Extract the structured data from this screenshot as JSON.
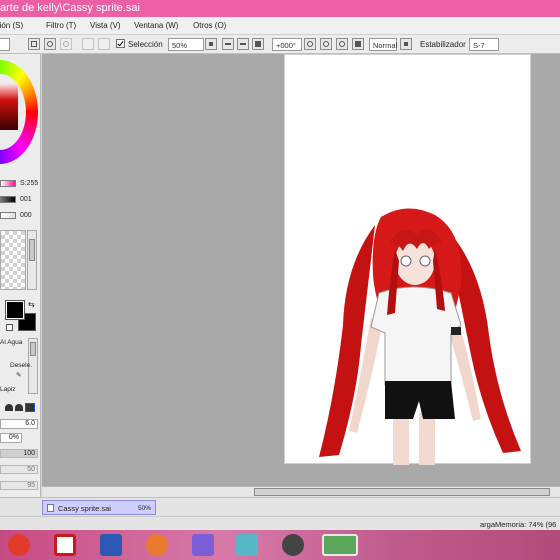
{
  "window": {
    "title": "arte de kelly\\Cassy sprite.sai"
  },
  "menu": [
    {
      "label": "Edición (S)"
    },
    {
      "label": "Filtro (T)"
    },
    {
      "label": "Vista (V)"
    },
    {
      "label": "Ventana (W)"
    },
    {
      "label": "Otros (O)"
    }
  ],
  "toolbar": {
    "selection_label": "Selección",
    "selection_checked": true,
    "zoom": "50%",
    "rotation": "+000°",
    "blend_mode": "Normal",
    "stabilizer_label": "Estabilizador",
    "stabilizer_value": "S-7"
  },
  "color_panel": {
    "primary_color": "#000000",
    "values": [
      "S:255",
      "001",
      "000"
    ]
  },
  "tool_panel": {
    "tool_a": "Al Agua",
    "tool_b": "Desele.",
    "tool_c": "Lapiz",
    "brush_size": "6.0",
    "min_size": "0%",
    "density": "100",
    "bar_a": "50",
    "bar_b": "95"
  },
  "document_tab": {
    "name": "Cassy sprite.sai",
    "zoom": "50%"
  },
  "status": {
    "memory": "argaMemoria: 74% (96"
  },
  "taskbar": {
    "icons": [
      "opera-icon",
      "daz-icon",
      "word-icon",
      "firefox-icon",
      "game-icon",
      "gimp-icon",
      "flash-icon",
      "photoshop-icon"
    ]
  },
  "colors": {
    "titlebar": "#ec5fa4",
    "canvas_bg": "#a9a9a9",
    "tab_active": "#cfcfff",
    "taskbar": "#c64a82"
  }
}
